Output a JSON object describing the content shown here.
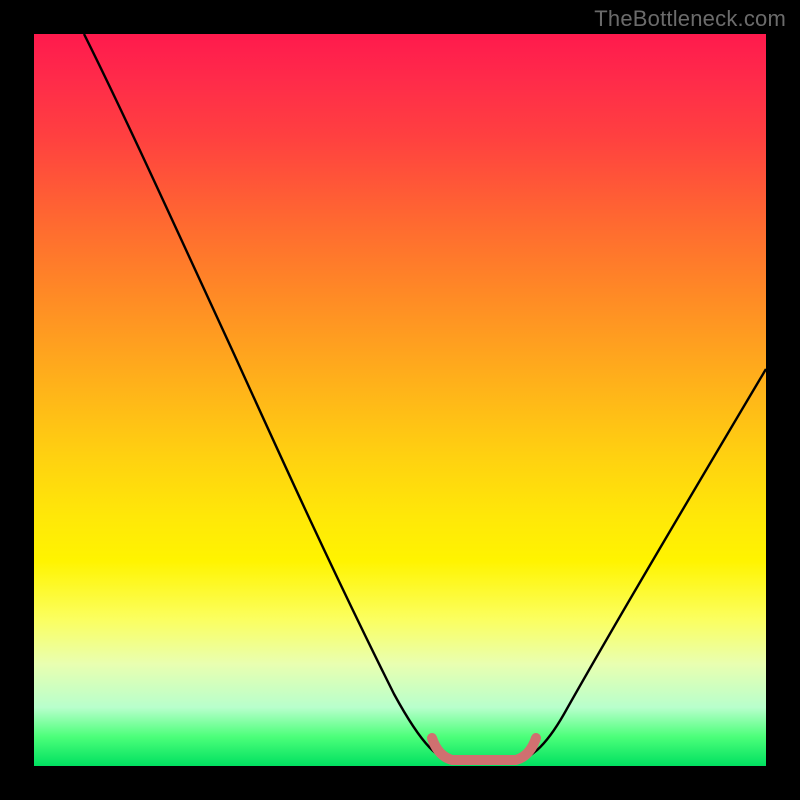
{
  "watermark": "TheBottleneck.com",
  "chart_data": {
    "type": "line",
    "title": "",
    "xlabel": "",
    "ylabel": "",
    "x_range_fraction": [
      0,
      1
    ],
    "y_range_percent": [
      0,
      100
    ],
    "grid": false,
    "background_gradient": {
      "top": "#ff1a4d",
      "bottom": "#00e060",
      "meaning": "red = high bottleneck, green = low bottleneck"
    },
    "series": [
      {
        "name": "bottleneck-curve",
        "color": "#000000",
        "x": [
          0.07,
          0.12,
          0.18,
          0.24,
          0.3,
          0.36,
          0.42,
          0.48,
          0.54,
          0.57,
          0.6,
          0.63,
          0.66,
          0.72,
          0.78,
          0.84,
          0.9,
          0.96,
          1.0
        ],
        "y": [
          100,
          90,
          78,
          66,
          54,
          42,
          30,
          18,
          6,
          1,
          0,
          0,
          1,
          8,
          18,
          28,
          38,
          48,
          54
        ],
        "note": "y is bottleneck percent; valley plateau ≈ x 0.57–0.66"
      },
      {
        "name": "optimal-marker",
        "color": "#d96a6a",
        "x": [
          0.55,
          0.57,
          0.59,
          0.61,
          0.63,
          0.65,
          0.67
        ],
        "y": [
          2,
          0.5,
          0,
          0,
          0,
          0.5,
          2
        ],
        "note": "thick pink U at valley floor indicating optimal region"
      }
    ]
  }
}
